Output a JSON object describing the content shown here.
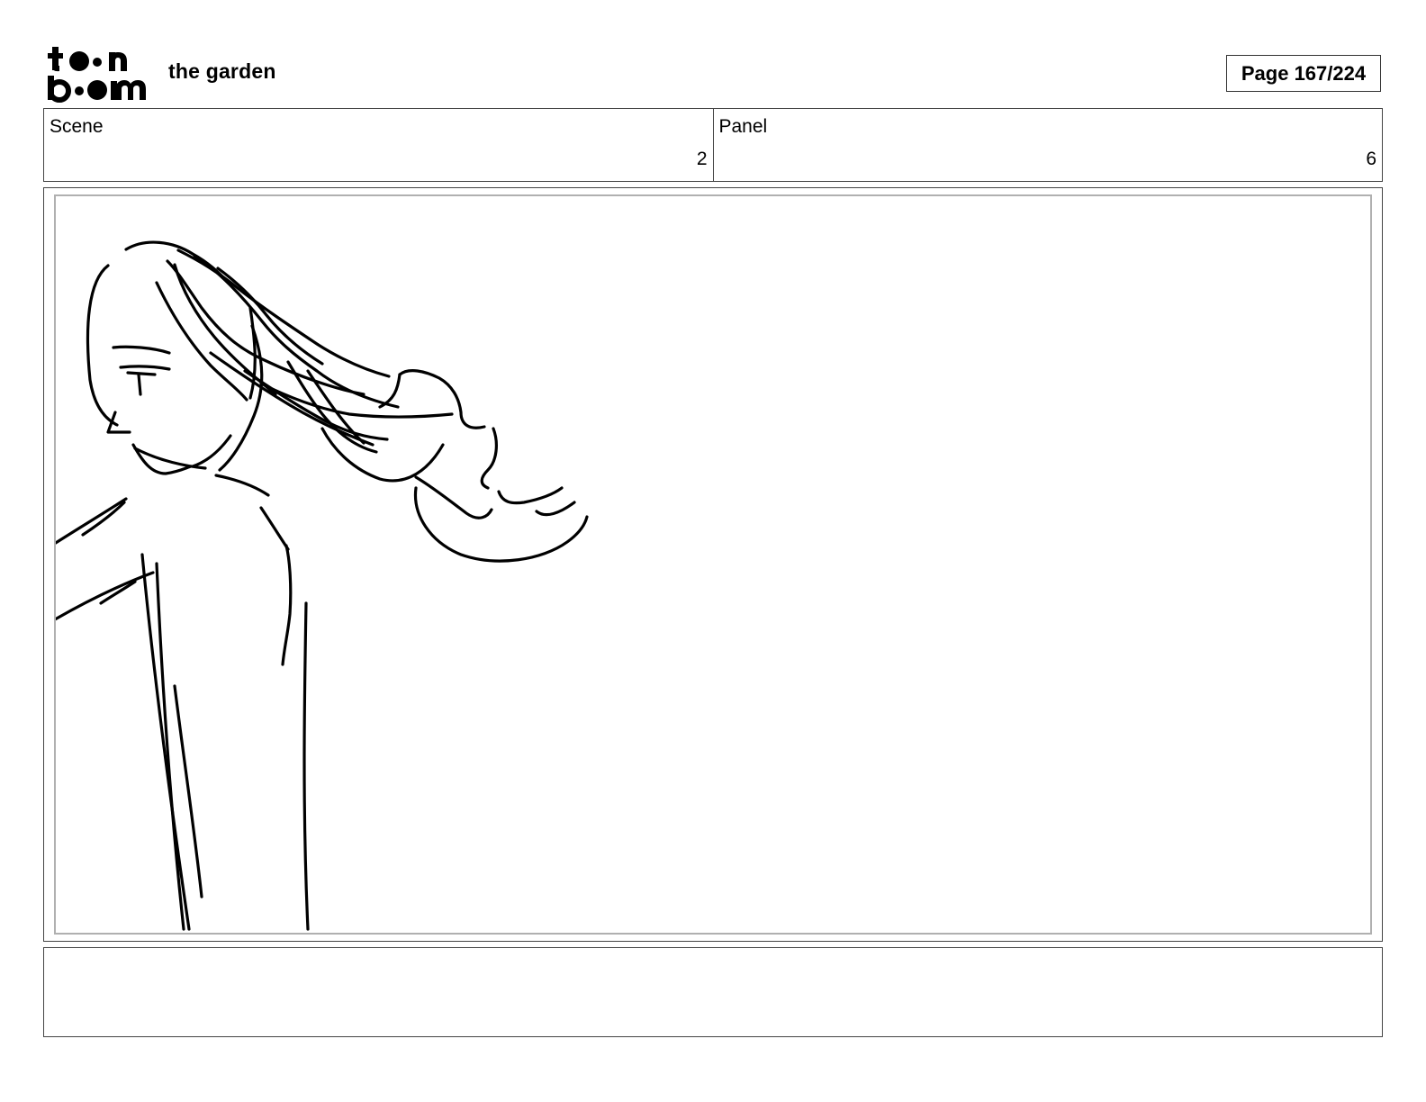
{
  "header": {
    "logo_text": "toon boom",
    "project_title": "the garden",
    "page_label": "Page 167/224"
  },
  "info": {
    "scene_label": "Scene",
    "scene_value": "2",
    "panel_label": "Panel",
    "panel_value": "6"
  },
  "sketch": {
    "subject": "figure-with-windblown-hair",
    "stroke_color": "#000000"
  },
  "notes": {
    "text": ""
  }
}
